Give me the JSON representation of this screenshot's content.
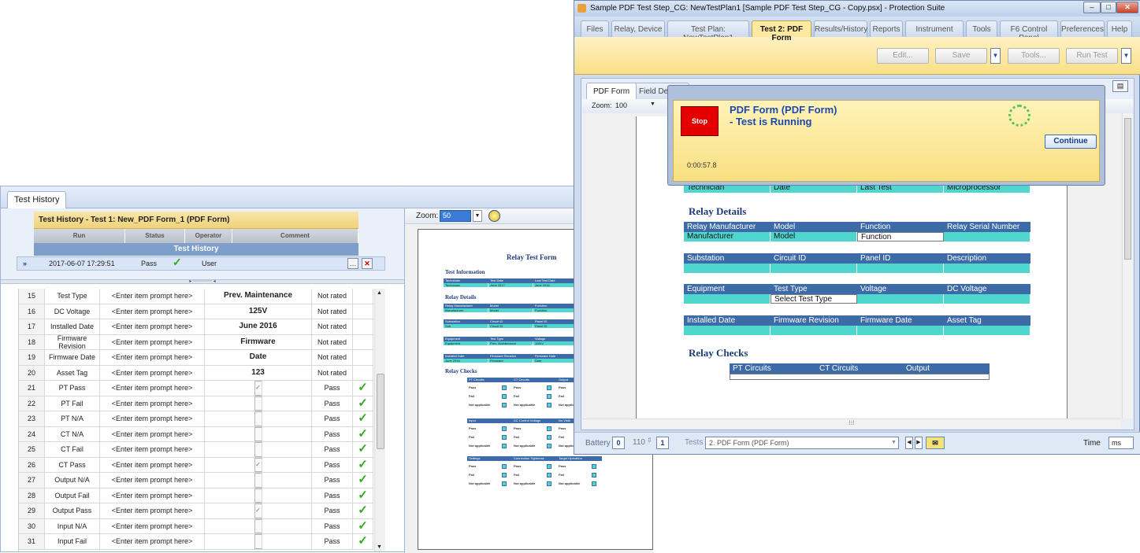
{
  "history": {
    "tab": "Test History",
    "header": "Test History -  Test 1:  New_PDF Form_1  (PDF Form)",
    "columns": [
      "Run",
      "Status",
      "Operator",
      "Comment"
    ],
    "band": "Test History",
    "row": {
      "marker": "»",
      "run": "2017-06-07 17:29:51",
      "status": "Pass",
      "operator": "User"
    },
    "rows": [
      {
        "num": "15",
        "name": "Test Type",
        "prompt": "<Enter item prompt here>",
        "value": "Prev. Maintenance",
        "kind": "text",
        "result": "Not rated",
        "ok": false
      },
      {
        "num": "16",
        "name": "DC Voltage",
        "prompt": "<Enter item prompt here>",
        "value": "125V",
        "kind": "text",
        "result": "Not rated",
        "ok": false
      },
      {
        "num": "17",
        "name": "Installed Date",
        "prompt": "<Enter item prompt here>",
        "value": "June 2016",
        "kind": "text",
        "result": "Not rated",
        "ok": false
      },
      {
        "num": "18",
        "name": "Firmware Revision",
        "prompt": "<Enter item prompt here>",
        "value": "Firmware",
        "kind": "text",
        "result": "Not rated",
        "ok": false
      },
      {
        "num": "19",
        "name": "Firmware Date",
        "prompt": "<Enter item prompt here>",
        "value": "Date",
        "kind": "text",
        "result": "Not rated",
        "ok": false
      },
      {
        "num": "20",
        "name": "Asset Tag",
        "prompt": "<Enter item prompt here>",
        "value": "123",
        "kind": "text",
        "result": "Not rated",
        "ok": false
      },
      {
        "num": "21",
        "name": "PT Pass",
        "prompt": "<Enter item prompt here>",
        "value": "✓",
        "kind": "check",
        "result": "Pass",
        "ok": true
      },
      {
        "num": "22",
        "name": "PT Fail",
        "prompt": "<Enter item prompt here>",
        "value": "",
        "kind": "check",
        "result": "Pass",
        "ok": true
      },
      {
        "num": "23",
        "name": "PT N/A",
        "prompt": "<Enter item prompt here>",
        "value": "",
        "kind": "check",
        "result": "Pass",
        "ok": true
      },
      {
        "num": "24",
        "name": "CT N/A",
        "prompt": "<Enter item prompt here>",
        "value": "",
        "kind": "check",
        "result": "Pass",
        "ok": true
      },
      {
        "num": "25",
        "name": "CT Fail",
        "prompt": "<Enter item prompt here>",
        "value": "",
        "kind": "check",
        "result": "Pass",
        "ok": true
      },
      {
        "num": "26",
        "name": "CT Pass",
        "prompt": "<Enter item prompt here>",
        "value": "✓",
        "kind": "check",
        "result": "Pass",
        "ok": true
      },
      {
        "num": "27",
        "name": "Output N/A",
        "prompt": "<Enter item prompt here>",
        "value": "",
        "kind": "check",
        "result": "Pass",
        "ok": true
      },
      {
        "num": "28",
        "name": "Output Fail",
        "prompt": "<Enter item prompt here>",
        "value": "",
        "kind": "check",
        "result": "Pass",
        "ok": true
      },
      {
        "num": "29",
        "name": "Output Pass",
        "prompt": "<Enter item prompt here>",
        "value": "✓",
        "kind": "check",
        "result": "Pass",
        "ok": true
      },
      {
        "num": "30",
        "name": "Input N/A",
        "prompt": "<Enter item prompt here>",
        "value": "",
        "kind": "check",
        "result": "Pass",
        "ok": true
      },
      {
        "num": "31",
        "name": "Input Fail",
        "prompt": "<Enter item prompt here>",
        "value": "",
        "kind": "check",
        "result": "Pass",
        "ok": true
      }
    ],
    "zoom_label": "Zoom:",
    "zoom_value": "50",
    "mini": {
      "title": "Relay Test Form",
      "sections": [
        "Test Information",
        "Relay Details",
        "Relay Checks"
      ],
      "labels": [
        "Technician",
        "Test Date",
        "Last Test Date",
        "Technician",
        "June 2017",
        "June 2016",
        "Relay Manufacturer",
        "Model",
        "Function",
        "Manufacturer",
        "Model",
        "Function",
        "Substation",
        "Circuit ID",
        "Panel ID",
        "Sub",
        "Circuit ID",
        "Panel ID",
        "Equipment",
        "Test Type",
        "Voltage",
        "Equipment",
        "Prev. Maintenance",
        "110kV",
        "Installed Date",
        "Firmware Revision",
        "Firmware Date",
        "June 2016",
        "Firmware",
        "Date"
      ],
      "checks": [
        {
          "heads": [
            "PT Circuits",
            "CT Circuits",
            "Output"
          ]
        },
        {
          "heads": [
            "Input",
            "DC Control Voltage",
            "No Visib"
          ]
        },
        {
          "heads": [
            "Settings",
            "Connection Tightness",
            "Target Operation"
          ]
        }
      ],
      "check_rows": [
        "Pass",
        "Fail",
        "Not applicable"
      ]
    }
  },
  "window": {
    "title": "Sample PDF Test Step_CG: NewTestPlan1 [Sample PDF Test Step_CG - Copy.psx] - Protection Suite",
    "tabs": [
      "Files",
      "Relay, Device",
      "Test Plan: NewTestPlan1",
      "Test 2: PDF Form",
      "Results/History",
      "Reports",
      "Instrument",
      "Tools",
      "F6 Control Panel",
      "Preferences",
      "Help"
    ],
    "buttons": {
      "edit": "Edit...",
      "save": "Save",
      "tools": "Tools...",
      "run": "Run Test"
    },
    "inner_tabs": [
      "PDF Form",
      "Field Details"
    ],
    "zoom_label": "Zoom:",
    "zoom_value": "100",
    "form": {
      "test_information": "Test Information",
      "ti_heads": [
        "Technician",
        "Test Date",
        "Last Test Date",
        "Relay Type"
      ],
      "ti_vals": [
        "Technician",
        "Date",
        "Last Test",
        "Microprocessor"
      ],
      "relay_details": "Relay Details",
      "rd1_heads": [
        "Relay Manufacturer",
        "Model",
        "Function",
        "Relay Serial Number"
      ],
      "rd1_vals": [
        "Manufacturer",
        "Model",
        "Function",
        ""
      ],
      "rd2_heads": [
        "Substation",
        "Circuit  ID",
        "Panel ID",
        "Description"
      ],
      "rd3_heads": [
        "Equipment",
        "Test Type",
        "Voltage",
        "DC Voltage"
      ],
      "rd3_vals": [
        "",
        "Select Test Type",
        "",
        ""
      ],
      "rd4_heads": [
        "Installed Date",
        "Firmware Revision",
        "Firmware Date",
        "Asset Tag"
      ],
      "relay_checks": "Relay Checks",
      "rc_heads": [
        "PT Circuits",
        "CT Circuits",
        "Output"
      ]
    },
    "status": {
      "battery": "Battery",
      "battery_val": "0",
      "count": "110",
      "step": "1",
      "tests_label": "Tests",
      "tests_value": "2. PDF Form (PDF Form)",
      "time_label": "Time",
      "time_unit": "ms"
    }
  },
  "popup": {
    "stop": "Stop",
    "line1": "PDF Form (PDF Form)",
    "line2": "- Test is Running",
    "continue": "Continue",
    "elapsed": "0:00:57.8"
  }
}
